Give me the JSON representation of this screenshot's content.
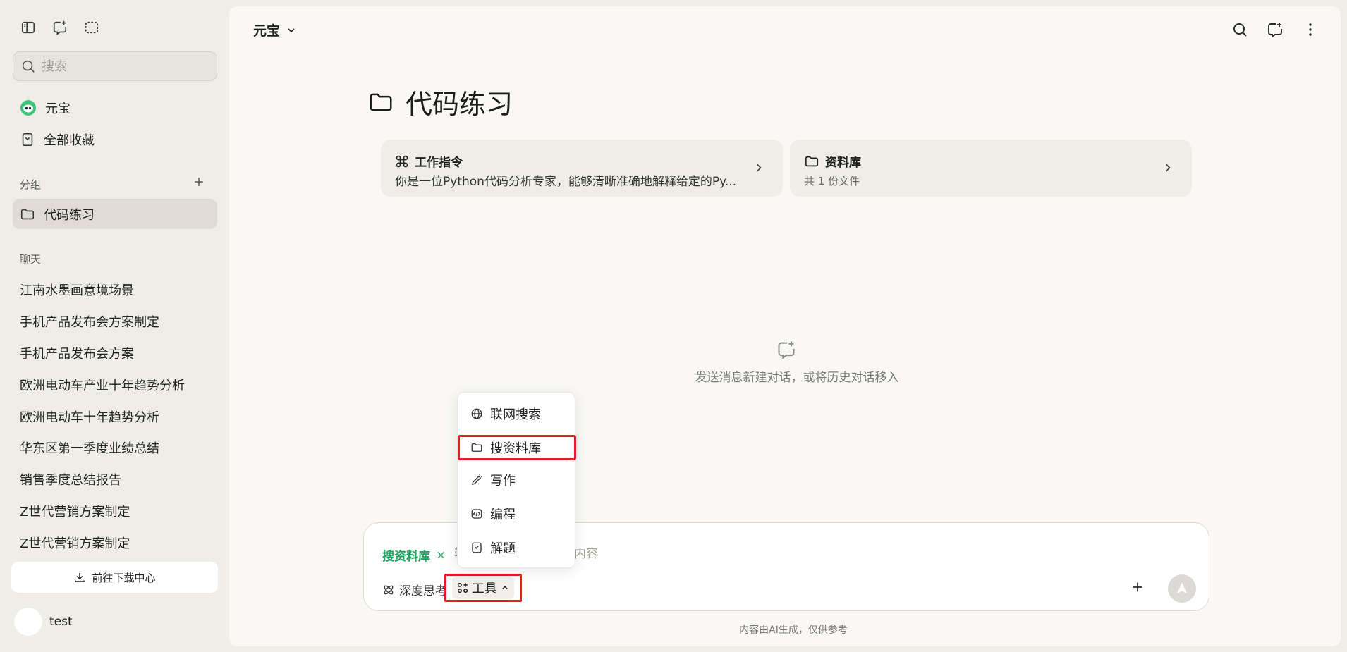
{
  "sidebar": {
    "search_placeholder": "搜索",
    "nav": [
      {
        "label": "元宝",
        "icon": "yuanbao-logo-icon"
      },
      {
        "label": "全部收藏",
        "icon": "bookmark-icon"
      }
    ],
    "groups_title": "分组",
    "groups": [
      {
        "label": "代码练习",
        "icon": "folder-icon"
      }
    ],
    "chats_title": "聊天",
    "chats": [
      "江南水墨画意境场景",
      "手机产品发布会方案制定",
      "手机产品发布会方案",
      "欧洲电动车产业十年趋势分析",
      "欧洲电动车十年趋势分析",
      "华东区第一季度业绩总结",
      "销售季度总结报告",
      "Z世代营销方案制定",
      "Z世代营销方案制定"
    ],
    "download_label": "前往下载中心",
    "user_name": "test"
  },
  "header": {
    "model_label": "元宝"
  },
  "main": {
    "title": "代码练习",
    "cards": [
      {
        "icon": "command-icon",
        "title": "工作指令",
        "subtitle": "你是一位Python代码分析专家，能够清晰准确地解释给定的Py..."
      },
      {
        "icon": "folder-icon",
        "title": "资料库",
        "subtitle": "共 1 份文件"
      }
    ],
    "empty_hint": "发送消息新建对话，或将历史对话移入"
  },
  "composer": {
    "tag_label": "搜资料库",
    "tag_close": "×",
    "placeholder": "输入问题，搜索资料库内容",
    "deep_think_label": "深度思考",
    "tools_label": "工具",
    "disclaimer": "内容由AI生成，仅供参考"
  },
  "tools_menu": {
    "items": [
      {
        "label": "联网搜索",
        "icon": "globe-icon"
      },
      {
        "label": "搜资料库",
        "icon": "folder-icon"
      },
      {
        "label": "写作",
        "icon": "pen-icon"
      },
      {
        "label": "编程",
        "icon": "code-icon"
      },
      {
        "label": "解题",
        "icon": "check-square-icon"
      }
    ]
  },
  "colors": {
    "accent_green": "#1ca860",
    "highlight_red": "#e02020",
    "sidebar_bg": "#efede8",
    "main_bg": "#f9f8f5"
  }
}
